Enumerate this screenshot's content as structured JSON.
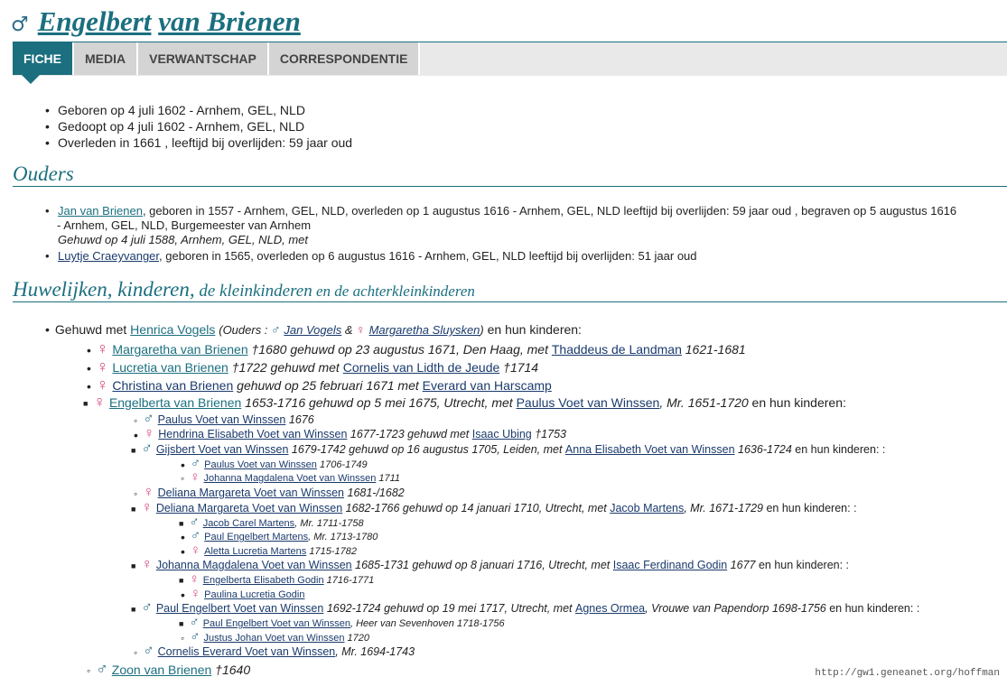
{
  "header": {
    "symbol": "♂",
    "first_name": "Engelbert",
    "last_name": "van Brienen"
  },
  "tabs": [
    {
      "label": "FICHE"
    },
    {
      "label": "MEDIA"
    },
    {
      "label": "VERWANTSCHAP"
    },
    {
      "label": "CORRESPONDENTIE"
    }
  ],
  "facts": [
    "Geboren op 4 juli 1602 - Arnhem, GEL, NLD",
    "Gedoopt op 4 juli 1602 - Arnhem, GEL, NLD",
    "Overleden in 1661 , leeftijd bij overlijden: 59 jaar oud"
  ],
  "parents": {
    "title": "Ouders",
    "father": {
      "name": "Jan van Brienen",
      "text1": ", geboren in 1557 - Arnhem, GEL, NLD, overleden op 1 augustus 1616 - Arnhem, GEL, NLD leeftijd bij overlijden: 59 jaar oud , begraven op 5 augustus 1616",
      "text2": "- Arnhem, GEL, NLD, Burgemeester van Arnhem",
      "married": "Gehuwd op 4 juli 1588, Arnhem, GEL, NLD, met"
    },
    "mother": {
      "name": "Luytje Craeyvanger",
      "text": ", geboren in 1565, overleden op 6 augustus 1616 - Arnhem, GEL, NLD leeftijd bij overlijden: 51 jaar oud"
    }
  },
  "marriages": {
    "title_big": "Huwelijken, kinderen,",
    "title_small": " de kleinkinderen",
    "title_small2": " en de achterkleinkinderen",
    "spouse_prefix": "Gehuwd met ",
    "spouse": "Henrica Vogels",
    "parents_prefix": "(Ouders : ",
    "sp_father": "Jan Vogels",
    "amp": " & ",
    "sp_mother": "Margaretha Sluysken",
    "parents_suffix": ")",
    "suffix": " en hun kinderen:"
  },
  "children": [
    {
      "sym": "♀",
      "name": "Margaretha van Brienen",
      "t1": " †1680  gehuwd op 23 augustus 1671, Den Haag, met ",
      "spouse": "Thaddeus de Landman",
      "t2": " 1621-1681",
      "t3": ""
    },
    {
      "sym": "♀",
      "name": "Lucretia van Brienen",
      "t1": " †1722  gehuwd met ",
      "spouse": "Cornelis van Lidth de Jeude",
      "t2": " †1714",
      "t3": ""
    },
    {
      "sym": "♀",
      "name": "Christina van Brienen",
      "t1": "  gehuwd op 25 februari 1671 met ",
      "spouse": "Everard van Harscamp",
      "t2": "",
      "t3": ""
    },
    {
      "sym": "♀",
      "name": "Engelberta van Brienen",
      "t1": " 1653-1716  gehuwd op 5 mei 1675, Utrecht, met ",
      "spouse": "Paulus Voet van Winssen",
      "t2": ", Mr. 1651-1720",
      "t3": " en hun kinderen:"
    }
  ],
  "grandchildren": [
    {
      "sym": "♂",
      "name": "Paulus Voet van Winssen",
      "t1": " 1676",
      "spouse": "",
      "t2": "",
      "t3": ""
    },
    {
      "sym": "♀",
      "name": "Hendrina Elisabeth Voet van Winssen",
      "t1": " 1677-1723 gehuwd met ",
      "spouse": "Isaac Ubing",
      "t2": " †1753",
      "t3": ""
    },
    {
      "sym": "♂",
      "name": "Gijsbert Voet van Winssen",
      "t1": " 1679-1742 gehuwd op 16 augustus 1705, Leiden, met ",
      "spouse": "Anna Elisabeth Voet van Winssen",
      "t2": " 1636-1724",
      "t3": " en hun kinderen: :"
    },
    {
      "sym": "♀",
      "name": "Deliana Margareta Voet van Winssen",
      "t1": " 1681-/1682",
      "spouse": "",
      "t2": "",
      "t3": ""
    },
    {
      "sym": "♀",
      "name": "Deliana Margareta Voet van Winssen",
      "t1": " 1682-1766 gehuwd op 14 januari 1710, Utrecht, met ",
      "spouse": "Jacob Martens",
      "t2": ", Mr. 1671-1729",
      "t3": " en hun kinderen: :"
    },
    {
      "sym": "♀",
      "name": "Johanna Magdalena Voet van Winssen",
      "t1": " 1685-1731 gehuwd op 8 januari 1716, Utrecht, met ",
      "spouse": "Isaac Ferdinand Godin",
      "t2": " 1677",
      "t3": " en hun kinderen: :"
    },
    {
      "sym": "♂",
      "name": "Paul Engelbert Voet van Winssen",
      "t1": " 1692-1724 gehuwd op 19 mei 1717, Utrecht, met ",
      "spouse": "Agnes Ormea",
      "t2": ", Vrouwe van Papendorp 1698-1756",
      "t3": " en hun kinderen: :"
    },
    {
      "sym": "♂",
      "name": "Cornelis Everard Voet van Winssen",
      "t1": ", Mr. 1694-1743",
      "spouse": "",
      "t2": "",
      "t3": ""
    }
  ],
  "great_grandchildren": [
    {
      "sym": "♂",
      "name": "Paulus Voet van Winssen",
      "t1": " 1706-1749"
    },
    {
      "sym": "♀",
      "name": "Johanna Magdalena Voet van Winssen",
      "t1": " 1711"
    },
    {
      "sym": "♂",
      "name": "Jacob Carel Martens",
      "t1": ", Mr. 1711-1758"
    },
    {
      "sym": "♂",
      "name": "Paul Engelbert Martens",
      "t1": ", Mr. 1713-1780"
    },
    {
      "sym": "♀",
      "name": "Aletta Lucretia Martens",
      "t1": " 1715-1782"
    },
    {
      "sym": "♀",
      "name": "Engelberta Elisabeth Godin",
      "t1": " 1716-1771"
    },
    {
      "sym": "♀",
      "name": "Paulina Lucretia Godin",
      "t1": ""
    },
    {
      "sym": "♂",
      "name": "Paul Engelbert Voet van Winssen",
      "t1": ", Heer van Sevenhoven 1718-1756"
    },
    {
      "sym": "♂",
      "name": "Justus Johan Voet van Winssen",
      "t1": " 1720"
    }
  ],
  "last_child": {
    "sym": "♂",
    "name": "Zoon van Brienen",
    "t1": " †1640"
  },
  "footer": "http://gw1.geneanet.org/hoffman",
  "colors": {
    "accent": "#1b6f7f",
    "male": "#2a6c85",
    "female": "#d4457b",
    "link": "#1a3a6c"
  }
}
